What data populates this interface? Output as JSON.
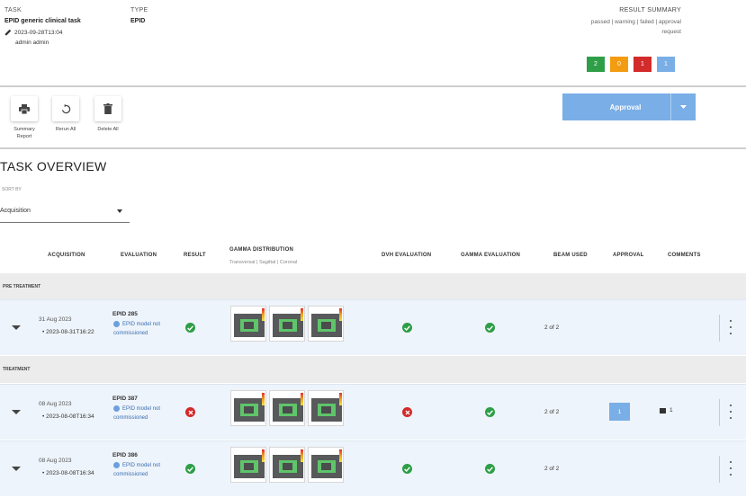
{
  "header": {
    "task_label": "TASK",
    "task_name": "EPID generic clinical task",
    "task_timestamp": "2023-09-28T13:04",
    "task_user": "admin admin",
    "type_label": "TYPE",
    "type_value": "EPID",
    "result_summary_label": "RESULT SUMMARY",
    "result_summary_legend_1": "passed | warning | failed | approval",
    "result_summary_legend_2": "request",
    "badges": [
      {
        "value": "2",
        "color": "#2e9e47"
      },
      {
        "value": "0",
        "color": "#f39c12"
      },
      {
        "value": "1",
        "color": "#d32a2a"
      },
      {
        "value": "1",
        "color": "#7aaee6"
      }
    ]
  },
  "toolbar": {
    "tools": [
      {
        "label_1": "Summary",
        "label_2": "Report",
        "icon": "printer-icon"
      },
      {
        "label_1": "Rerun All",
        "label_2": "",
        "icon": "refresh-icon"
      },
      {
        "label_1": "Delete All",
        "label_2": "",
        "icon": "trash-icon"
      }
    ],
    "approval_label": "Approval"
  },
  "overview": {
    "title": "TASK OVERVIEW",
    "sort_label": "SORT BY",
    "sort_value": "Acquisition"
  },
  "table": {
    "columns": [
      "ACQUISITION",
      "EVALUATION",
      "RESULT",
      "GAMMA DISTRIBUTION",
      "DVH EVALUATION",
      "GAMMA EVALUATION",
      "BEAM USED",
      "APPROVAL",
      "COMMENTS"
    ],
    "gamma_subheader": "Transversal | Sagittal | Coronal",
    "sections": [
      {
        "label": "PRE TREATMENT",
        "rows": [
          {
            "date": "31 Aug 2023",
            "timestamp": "2023-08-31T16:22",
            "eval_name": "EPID 285",
            "eval_msg": "EPID model not commissioned",
            "result": "ok",
            "dvh": "ok",
            "gamma": "ok",
            "beams": "2 of 2",
            "approval": "",
            "comments": ""
          }
        ]
      },
      {
        "label": "TREATMENT",
        "rows": [
          {
            "date": "08 Aug 2023",
            "timestamp": "2023-08-08T16:34",
            "eval_name": "EPID 387",
            "eval_msg": "EPID model not commissioned",
            "result": "fail",
            "dvh": "fail",
            "gamma": "ok",
            "beams": "2 of 2",
            "approval": "1",
            "comments": "1"
          },
          {
            "date": "08 Aug 2023",
            "timestamp": "2023-08-08T16:34",
            "eval_name": "EPID 386",
            "eval_msg": "EPID model not commissioned",
            "result": "ok",
            "dvh": "ok",
            "gamma": "ok",
            "beams": "2 of 2",
            "approval": "",
            "comments": ""
          }
        ]
      }
    ]
  }
}
